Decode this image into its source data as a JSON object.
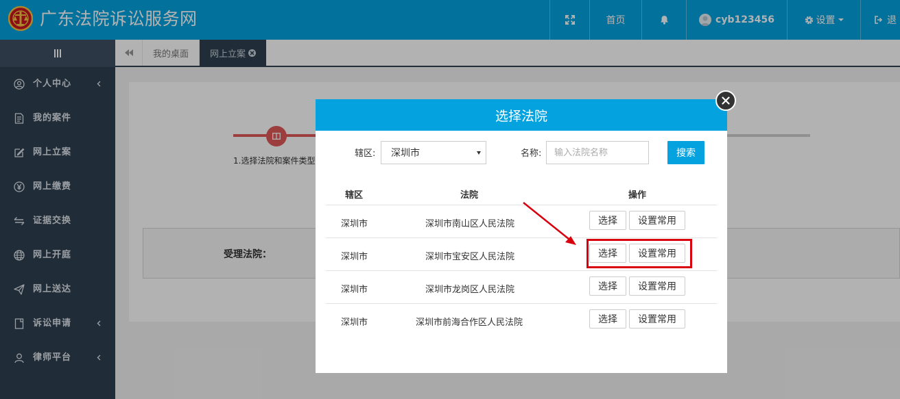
{
  "header": {
    "site_title": "广东法院诉讼服务网",
    "nav": {
      "fullscreen_icon": "expand-icon",
      "home_label": "首页",
      "notification_icon": "bell-icon",
      "user_label": "cyb123456",
      "settings_label": "设置",
      "logout_label": "退"
    }
  },
  "sidebar": {
    "toggle_icon": "menu-bars-icon",
    "items": [
      {
        "label": "个人中心",
        "icon": "user-circle-icon",
        "has_arrow": true
      },
      {
        "label": "我的案件",
        "icon": "document-icon",
        "has_arrow": false
      },
      {
        "label": "网上立案",
        "icon": "edit-icon",
        "has_arrow": false
      },
      {
        "label": "网上缴费",
        "icon": "yen-icon",
        "has_arrow": false
      },
      {
        "label": "证据交换",
        "icon": "exchange-icon",
        "has_arrow": false
      },
      {
        "label": "网上开庭",
        "icon": "globe-icon",
        "has_arrow": false
      },
      {
        "label": "网上送达",
        "icon": "paper-plane-icon",
        "has_arrow": false
      },
      {
        "label": "诉讼申请",
        "icon": "file-icon",
        "has_arrow": true
      },
      {
        "label": "律师平台",
        "icon": "user-icon",
        "has_arrow": true
      }
    ]
  },
  "tabs": {
    "back_icon": "double-left-icon",
    "items": [
      {
        "label": "我的桌面",
        "active": false
      },
      {
        "label": "网上立案",
        "active": true
      }
    ]
  },
  "background_page": {
    "step_label": "1.选择法院和案件类型",
    "court_label": "受理法院："
  },
  "modal": {
    "title": "选择法院",
    "filter": {
      "district_label": "辖区:",
      "district_value": "深圳市",
      "name_label": "名称:",
      "name_placeholder": "输入法院名称",
      "search_label": "搜索"
    },
    "table": {
      "headers": [
        "辖区",
        "法院",
        "操作"
      ],
      "rows": [
        {
          "district": "深圳市",
          "court": "深圳市南山区人民法院"
        },
        {
          "district": "深圳市",
          "court": "深圳市宝安区人民法院"
        },
        {
          "district": "深圳市",
          "court": "深圳市龙岗区人民法院"
        },
        {
          "district": "深圳市",
          "court": "深圳市前海合作区人民法院"
        }
      ],
      "select_label": "选择",
      "set_common_label": "设置常用"
    }
  },
  "colors": {
    "header_blue": "#04a3e0",
    "sidebar_dark": "#2f4050",
    "annotation_red": "#d9000d",
    "step_red": "#e05a5a"
  }
}
